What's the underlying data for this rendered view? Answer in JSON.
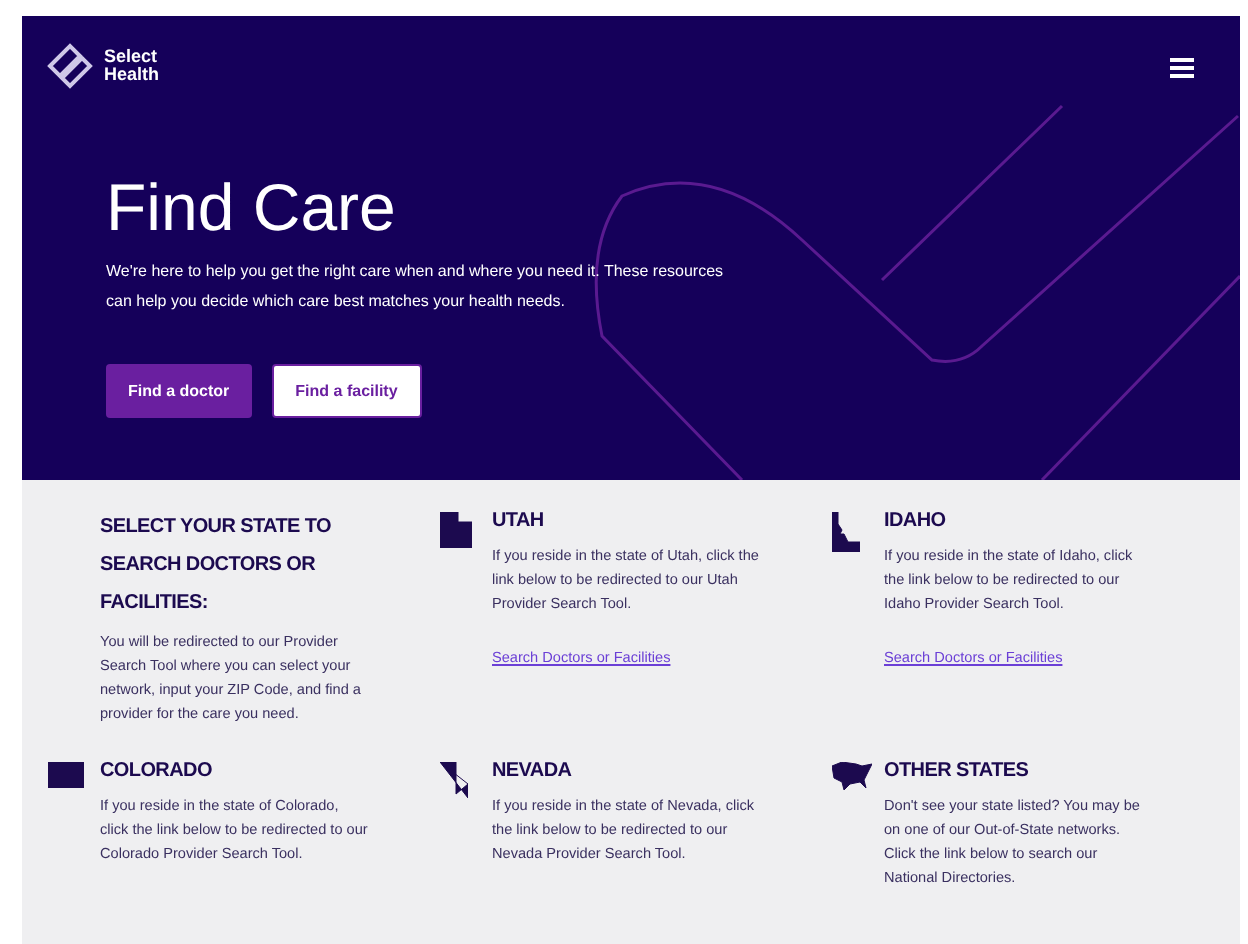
{
  "header": {
    "logo_text": [
      "Select",
      "Health"
    ]
  },
  "hero": {
    "title": "Find Care",
    "description": "We're here to help you get the right care when and where you need it. These resources can help you decide which care best matches your health needs.",
    "buttons": [
      {
        "label": "Find a doctor",
        "kind": "primary"
      },
      {
        "label": "Find a facility",
        "kind": "secondary"
      }
    ]
  },
  "intro": {
    "heading": "SELECT YOUR STATE TO SEARCH DOCTORS OR FACILITIES:",
    "text": "You will be redirected to our Provider Search Tool where you can select your network, input your ZIP Code, and find a provider for the care you need."
  },
  "states": [
    {
      "name": "UTAH",
      "text": "If you reside in the state of Utah, click the link below to be redirected to our Utah Provider Search Tool.",
      "link": "Search Doctors or Facilities"
    },
    {
      "name": "IDAHO",
      "text": "If you reside in the state of Idaho, click the link below to be redirected to our Idaho Provider Search Tool.",
      "link": "Search Doctors or Facilities"
    },
    {
      "name": "COLORADO",
      "text": "If you reside in the state of Colorado, click the link below to be redirected to our Colorado Provider Search Tool."
    },
    {
      "name": "NEVADA",
      "text": "If you reside in the state of Nevada, click the link below to be redirected to our Nevada Provider Search Tool."
    },
    {
      "name": "OTHER STATES",
      "text": "Don't see your state listed? You may be on one of our Out-of-State networks. Click the link below to search our National Directories."
    }
  ]
}
